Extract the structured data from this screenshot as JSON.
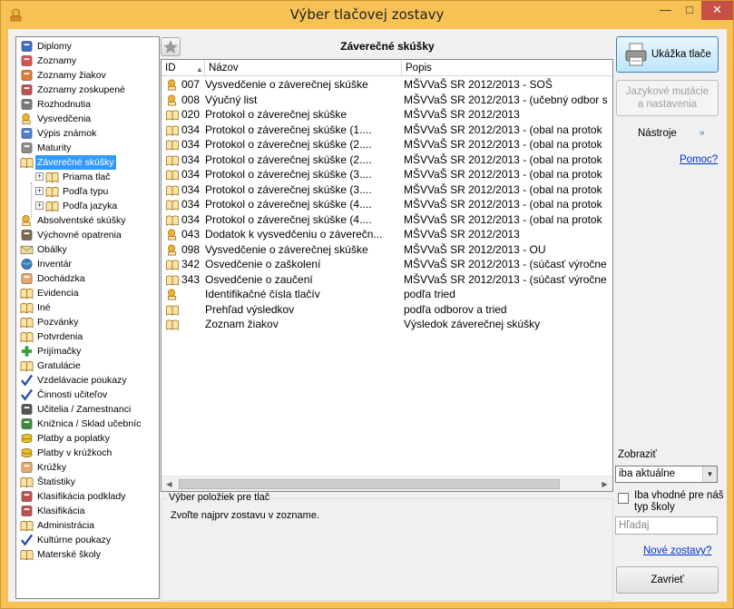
{
  "window": {
    "title": "Výber tlačovej zostavy"
  },
  "tree": {
    "items": [
      {
        "label": "Diplomy",
        "icon": "diploma-icon",
        "color": "#3a6cc8"
      },
      {
        "label": "Zoznamy",
        "icon": "person-icon",
        "color": "#d9534f"
      },
      {
        "label": "Zoznamy žiakov",
        "icon": "students-icon",
        "color": "#e07b2e"
      },
      {
        "label": "Zoznamy zoskupené",
        "icon": "group-icon",
        "color": "#c0504d"
      },
      {
        "label": "Rozhodnutia",
        "icon": "document-icon",
        "color": "#7a7a7a"
      },
      {
        "label": "Vysvedčenia",
        "icon": "certificate-icon",
        "color": "#f2b134"
      },
      {
        "label": "Výpis známok",
        "icon": "grades-icon",
        "color": "#4a7fd1"
      },
      {
        "label": "Maturity",
        "icon": "trophy-icon",
        "color": "#8c8c8c"
      },
      {
        "label": "Záverečné skúšky",
        "icon": "open-book-icon",
        "color": "#f2b134"
      },
      {
        "label": "Priama tlač",
        "icon": "open-book-icon",
        "color": "#f2b134"
      },
      {
        "label": "Podľa typu",
        "icon": "open-book-icon",
        "color": "#f2b134"
      },
      {
        "label": "Podľa jazyka",
        "icon": "open-book-icon",
        "color": "#f2b134"
      },
      {
        "label": "Absolventské skúšky",
        "icon": "certificate-icon",
        "color": "#f2b134"
      },
      {
        "label": "Výchovné opatrenia",
        "icon": "snail-icon",
        "color": "#7a6a4a"
      },
      {
        "label": "Obálky",
        "icon": "envelope-icon",
        "color": "#e8d9a0"
      },
      {
        "label": "Inventár",
        "icon": "globe-icon",
        "color": "#3d7cc9"
      },
      {
        "label": "Dochádzka",
        "icon": "hand-icon",
        "color": "#e8a86a"
      },
      {
        "label": "Evidencia",
        "icon": "book-icon",
        "color": "#f2b134"
      },
      {
        "label": "Iné",
        "icon": "book-icon",
        "color": "#f2b134"
      },
      {
        "label": "Pozvánky",
        "icon": "book-icon",
        "color": "#f2b134"
      },
      {
        "label": "Potvrdenia",
        "icon": "book-icon",
        "color": "#f2b134"
      },
      {
        "label": "Prijímačky",
        "icon": "plus-icon",
        "color": "#3a9a3a"
      },
      {
        "label": "Gratulácie",
        "icon": "book-icon",
        "color": "#f2b134"
      },
      {
        "label": "Vzdelávacie poukazy",
        "icon": "checkmark-icon",
        "color": "#2a4fb0"
      },
      {
        "label": "Činnosti učiteľov",
        "icon": "checkmark-icon",
        "color": "#2a4fb0"
      },
      {
        "label": "Učitelia / Zamestnanci",
        "icon": "teacher-icon",
        "color": "#555555"
      },
      {
        "label": "Knižnica / Sklad učebníc",
        "icon": "books-icon",
        "color": "#3a8a3a"
      },
      {
        "label": "Platby a poplatky",
        "icon": "coins-icon",
        "color": "#e8c12e"
      },
      {
        "label": "Platby v krúžkoch",
        "icon": "coins-icon",
        "color": "#e8c12e"
      },
      {
        "label": "Krúžky",
        "icon": "hand-icon",
        "color": "#e8a86a"
      },
      {
        "label": "Štatistiky",
        "icon": "book-icon",
        "color": "#f2b134"
      },
      {
        "label": "Klasifikácia podklady",
        "icon": "pencil-icon",
        "color": "#c0504d"
      },
      {
        "label": "Klasifikácia",
        "icon": "abc-icon",
        "color": "#c0504d"
      },
      {
        "label": "Administrácia",
        "icon": "book-icon",
        "color": "#f2b134"
      },
      {
        "label": "Kultúrne poukazy",
        "icon": "checkmark-icon",
        "color": "#2a4fb0"
      },
      {
        "label": "Materské školy",
        "icon": "book-icon",
        "color": "#f2b134"
      }
    ],
    "selected_index": 8
  },
  "report": {
    "title": "Záverečné skúšky",
    "columns": {
      "id": "ID",
      "name": "Názov",
      "desc": "Popis"
    },
    "rows": [
      {
        "icon": "certificate-icon",
        "id": "007",
        "name": "Vysvedčenie o záverečnej skúške",
        "desc": "MŠVVaŠ SR 2012/2013 - SOŠ"
      },
      {
        "icon": "certificate-icon",
        "id": "008",
        "name": "Výučný list",
        "desc": "MŠVVaŠ SR 2012/2013 - (učebný odbor s"
      },
      {
        "icon": "book-icon",
        "id": "020",
        "name": "Protokol o záverečnej skúške",
        "desc": "MŠVVaŠ SR 2012/2013"
      },
      {
        "icon": "book-icon",
        "id": "034",
        "name": "Protokol o záverečnej skúške (1....",
        "desc": "MŠVVaŠ SR 2012/2013 - (obal na protok"
      },
      {
        "icon": "book-icon",
        "id": "034",
        "name": "Protokol o záverečnej skúške (2....",
        "desc": "MŠVVaŠ SR 2012/2013 - (obal na protok"
      },
      {
        "icon": "book-icon",
        "id": "034",
        "name": "Protokol o záverečnej skúške (2....",
        "desc": "MŠVVaŠ SR 2012/2013 - (obal na protok"
      },
      {
        "icon": "book-icon",
        "id": "034",
        "name": "Protokol o záverečnej skúške (3....",
        "desc": "MŠVVaŠ SR 2012/2013 - (obal na protok"
      },
      {
        "icon": "book-icon",
        "id": "034",
        "name": "Protokol o záverečnej skúške (3....",
        "desc": "MŠVVaŠ SR 2012/2013 - (obal na protok"
      },
      {
        "icon": "book-icon",
        "id": "034",
        "name": "Protokol o záverečnej skúške (4....",
        "desc": "MŠVVaŠ SR 2012/2013 - (obal na protok"
      },
      {
        "icon": "book-icon",
        "id": "034",
        "name": "Protokol o záverečnej skúške (4....",
        "desc": "MŠVVaŠ SR 2012/2013 - (obal na protok"
      },
      {
        "icon": "certificate-icon",
        "id": "043",
        "name": "Dodatok k vysvedčeniu o záverečn...",
        "desc": "MŠVVaŠ SR 2012/2013"
      },
      {
        "icon": "certificate-icon",
        "id": "098",
        "name": "Vysvedčenie o záverečnej skúške",
        "desc": "MŠVVaŠ SR 2012/2013 - OU"
      },
      {
        "icon": "book-icon",
        "id": "342",
        "name": "Osvedčenie o zaškolení",
        "desc": "MŠVVaŠ SR 2012/2013 - (súčasť výročne"
      },
      {
        "icon": "book-icon",
        "id": "343",
        "name": "Osvedčenie o zaučení",
        "desc": "MŠVVaŠ SR 2012/2013 - (súčasť výročne"
      },
      {
        "icon": "certificate-icon",
        "id": "",
        "name": "Identifikačné čísla tlačív",
        "desc": "podľa tried"
      },
      {
        "icon": "book-icon",
        "id": "",
        "name": "Prehľad výsledkov",
        "desc": "podľa odborov a tried"
      },
      {
        "icon": "book-icon",
        "id": "",
        "name": "Zoznam žiakov",
        "desc": "Výsledok záverečnej skúšky"
      }
    ]
  },
  "selection_group": {
    "legend": "Výber položiek pre tlač",
    "message": "Zvoľte najprv zostavu v zozname."
  },
  "side": {
    "preview_label": "Ukážka tlače",
    "lang_label_1": "Jazykové mutácie",
    "lang_label_2": "a nastavenia",
    "tools_label": "Nástroje",
    "help_link": "Pomoc?",
    "show_label": "Zobraziť",
    "show_value": "iba aktuálne",
    "checkbox_label": "Iba vhodné pre náš typ školy",
    "search_placeholder": "Hľadaj",
    "new_reports_link": "Nové zostavy?",
    "close_label": "Zavrieť"
  },
  "colors": {
    "accent": "#3399ff",
    "titlebar": "#f7c155",
    "close": "#c74f44",
    "link": "#0033cc"
  }
}
